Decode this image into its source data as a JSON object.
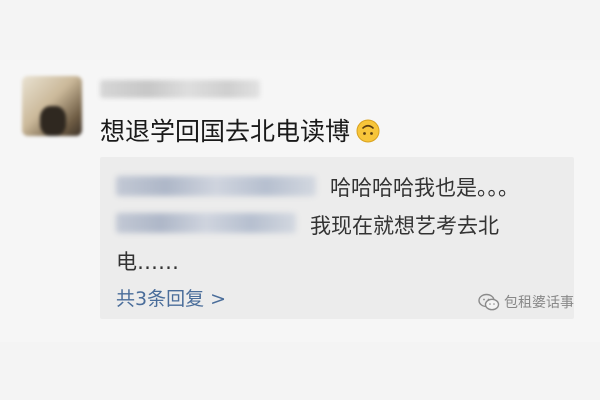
{
  "comment": {
    "text": "想退学回国去北电读博",
    "emoji": "upside-down-face-icon"
  },
  "replies": [
    {
      "text": "哈哈哈哈我也是。。。"
    },
    {
      "line1": "我现在就想艺考去北",
      "line2": "电……"
    }
  ],
  "more_replies": "共3条回复 >",
  "watermark": "包租婆话事",
  "colors": {
    "link": "#4a6d9a",
    "text": "#1a1a1a",
    "reply_bg": "#ececec"
  }
}
